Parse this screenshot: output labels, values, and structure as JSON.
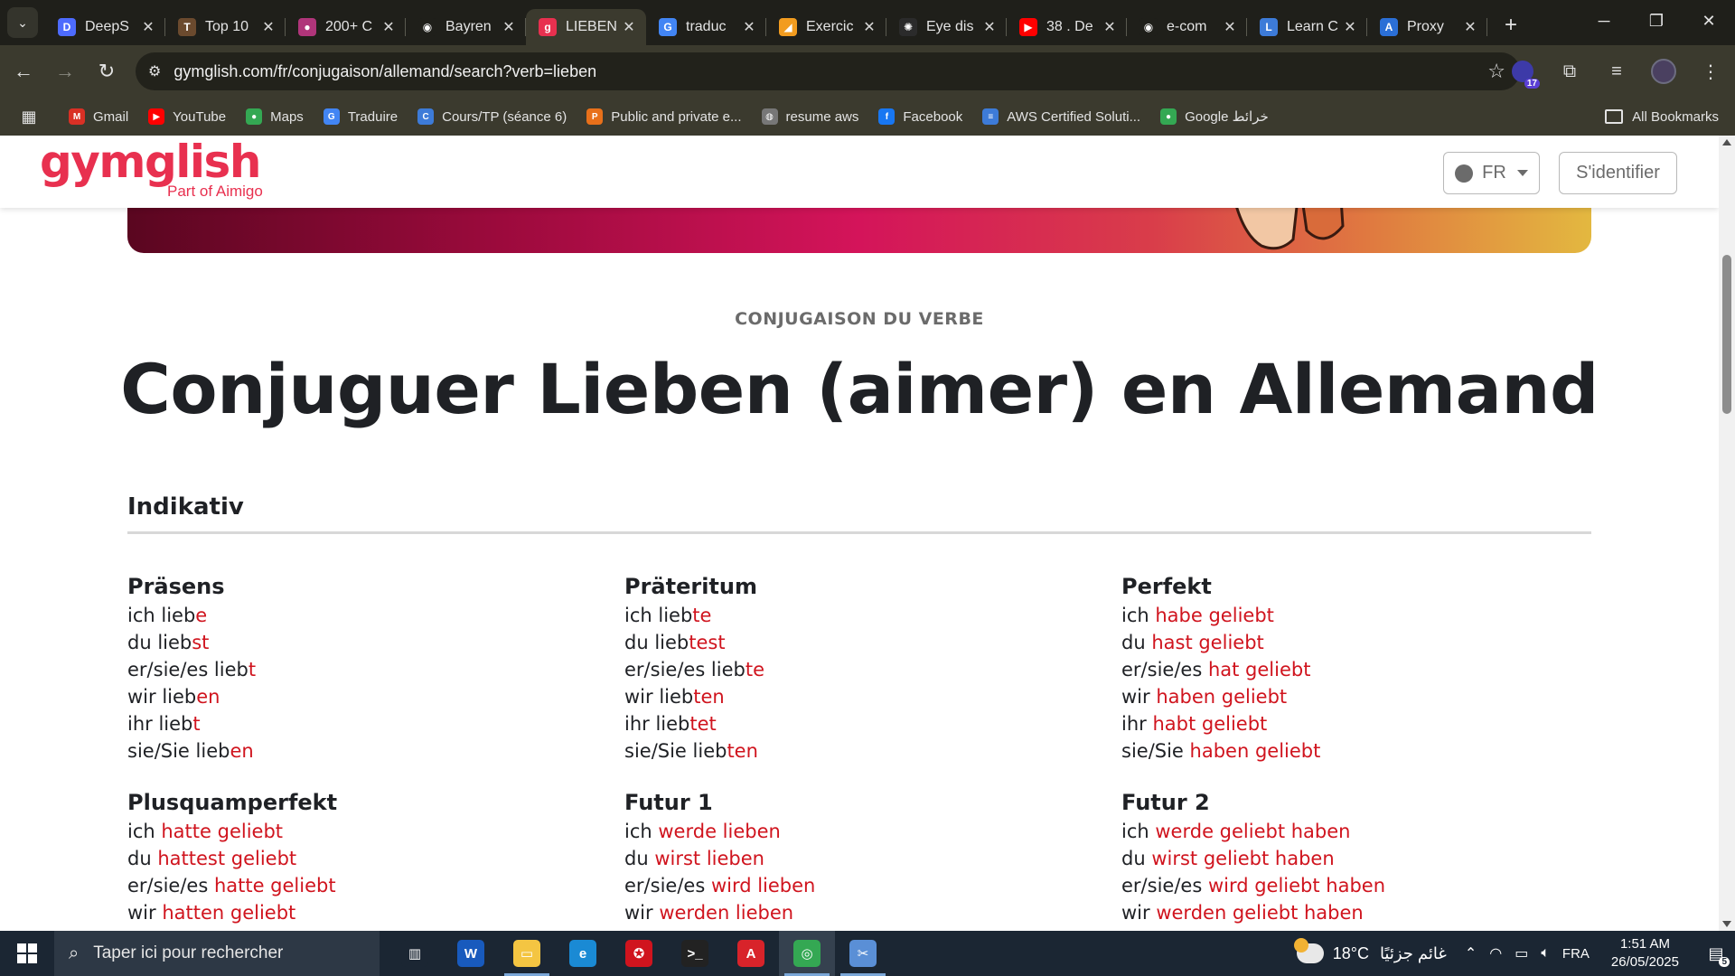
{
  "browser": {
    "tabs": [
      {
        "title": "DeepS",
        "favicon": "deepseek-icon",
        "color": "#4d6bfe",
        "glyph": "D"
      },
      {
        "title": "Top 10",
        "favicon": "page-icon",
        "color": "#6b4a2e",
        "glyph": "T"
      },
      {
        "title": "200+ C",
        "favicon": "colorful-icon",
        "color": "#b0357a",
        "glyph": "●"
      },
      {
        "title": "Bayren",
        "favicon": "github-icon",
        "color": "#1f1f1a",
        "glyph": "◉"
      },
      {
        "title": "LIEBEN",
        "favicon": "gymglish-icon",
        "color": "#e8304f",
        "glyph": "g"
      },
      {
        "title": "traduc",
        "favicon": "google-icon",
        "color": "#4285f4",
        "glyph": "G"
      },
      {
        "title": "Exercic",
        "favicon": "exercise-icon",
        "color": "#f29c1f",
        "glyph": "◢"
      },
      {
        "title": "Eye dis",
        "favicon": "openai-icon",
        "color": "#2b2b2b",
        "glyph": "✺"
      },
      {
        "title": "38 . De",
        "favicon": "youtube-icon",
        "color": "#ff0000",
        "glyph": "▶"
      },
      {
        "title": "e-com",
        "favicon": "github-icon",
        "color": "#1f1f1a",
        "glyph": "◉"
      },
      {
        "title": "Learn C",
        "favicon": "learn-icon",
        "color": "#3d7bd8",
        "glyph": "L"
      },
      {
        "title": "Proxy",
        "favicon": "proxy-icon",
        "color": "#2b6fd6",
        "glyph": "A"
      }
    ],
    "url": "gymglish.com/fr/conjugaison/allemand/search?verb=lieben",
    "extension_badge": "17",
    "bookmarks": [
      {
        "label": "Gmail",
        "icon": "gmail-icon",
        "color": "#d93025",
        "glyph": "M"
      },
      {
        "label": "YouTube",
        "icon": "youtube-icon",
        "color": "#ff0000",
        "glyph": "▶"
      },
      {
        "label": "Maps",
        "icon": "maps-icon",
        "color": "#34a853",
        "glyph": "●"
      },
      {
        "label": "Traduire",
        "icon": "translate-icon",
        "color": "#4285f4",
        "glyph": "G"
      },
      {
        "label": "Cours/TP (séance 6)",
        "icon": "classroom-icon",
        "color": "#3d7bd8",
        "glyph": "C"
      },
      {
        "label": "Public and private e...",
        "icon": "pluralsight-icon",
        "color": "#e8701a",
        "glyph": "P"
      },
      {
        "label": "resume aws",
        "icon": "globe-icon",
        "color": "#777777",
        "glyph": "◍"
      },
      {
        "label": "Facebook",
        "icon": "facebook-icon",
        "color": "#1877f2",
        "glyph": "f"
      },
      {
        "label": "AWS Certified Soluti...",
        "icon": "aws-icon",
        "color": "#3d7bd8",
        "glyph": "≡"
      },
      {
        "label": "Google خرائط",
        "icon": "maps-icon",
        "color": "#34a853",
        "glyph": "●"
      }
    ],
    "all_bookmarks": "All Bookmarks"
  },
  "site": {
    "logo_word": "gymglish",
    "logo_sub": "Part of Aimigo",
    "lang_label": "FR",
    "login_label": "S'identifier"
  },
  "main": {
    "eyebrow": "CONJUGAISON DU VERBE",
    "title": "Conjuguer Lieben (aimer) en Allemand",
    "mood": "Indikativ",
    "tenses": [
      {
        "name": "Präsens",
        "lines": [
          {
            "pre": "ich lieb",
            "end": "e"
          },
          {
            "pre": "du lieb",
            "end": "st"
          },
          {
            "pre": "er/sie/es lieb",
            "end": "t"
          },
          {
            "pre": "wir lieb",
            "end": "en"
          },
          {
            "pre": "ihr lieb",
            "end": "t"
          },
          {
            "pre": "sie/Sie lieb",
            "end": "en"
          }
        ]
      },
      {
        "name": "Präteritum",
        "lines": [
          {
            "pre": "ich lieb",
            "end": "te"
          },
          {
            "pre": "du lieb",
            "end": "test"
          },
          {
            "pre": "er/sie/es lieb",
            "end": "te"
          },
          {
            "pre": "wir lieb",
            "end": "ten"
          },
          {
            "pre": "ihr lieb",
            "end": "tet"
          },
          {
            "pre": "sie/Sie lieb",
            "end": "ten"
          }
        ]
      },
      {
        "name": "Perfekt",
        "lines": [
          {
            "pre": "ich ",
            "end": "habe geliebt"
          },
          {
            "pre": "du ",
            "end": "hast geliebt"
          },
          {
            "pre": "er/sie/es ",
            "end": "hat geliebt"
          },
          {
            "pre": "wir ",
            "end": "haben geliebt"
          },
          {
            "pre": "ihr ",
            "end": "habt geliebt"
          },
          {
            "pre": "sie/Sie ",
            "end": "haben geliebt"
          }
        ]
      },
      {
        "name": "Plusquamperfekt",
        "lines": [
          {
            "pre": "ich ",
            "end": "hatte geliebt"
          },
          {
            "pre": "du ",
            "end": "hattest geliebt"
          },
          {
            "pre": "er/sie/es ",
            "end": "hatte geliebt"
          },
          {
            "pre": "wir ",
            "end": "hatten geliebt"
          }
        ]
      },
      {
        "name": "Futur 1",
        "lines": [
          {
            "pre": "ich ",
            "end": "werde lieben"
          },
          {
            "pre": "du ",
            "end": "wirst lieben"
          },
          {
            "pre": "er/sie/es ",
            "end": "wird lieben"
          },
          {
            "pre": "wir ",
            "end": "werden lieben"
          }
        ]
      },
      {
        "name": "Futur 2",
        "lines": [
          {
            "pre": "ich ",
            "end": "werde geliebt haben"
          },
          {
            "pre": "du ",
            "end": "wirst geliebt haben"
          },
          {
            "pre": "er/sie/es ",
            "end": "wird geliebt haben"
          },
          {
            "pre": "wir ",
            "end": "werden geliebt haben"
          }
        ]
      }
    ]
  },
  "taskbar": {
    "search_placeholder": "Taper ici pour rechercher",
    "apps": [
      {
        "name": "task-view-icon",
        "color": "#1b2633",
        "glyph": "▥",
        "running": false
      },
      {
        "name": "word-icon",
        "color": "#185abd",
        "glyph": "W",
        "running": false
      },
      {
        "name": "file-explorer-icon",
        "color": "#f4c542",
        "glyph": "▭",
        "running": true
      },
      {
        "name": "edge-icon",
        "color": "#1a8ad4",
        "glyph": "e",
        "running": false
      },
      {
        "name": "app-red-icon",
        "color": "#d0141e",
        "glyph": "✪",
        "running": false
      },
      {
        "name": "terminal-icon",
        "color": "#222222",
        "glyph": ">_",
        "running": false
      },
      {
        "name": "acrobat-icon",
        "color": "#d8232a",
        "glyph": "A",
        "running": false
      },
      {
        "name": "chrome-icon",
        "color": "#34a853",
        "glyph": "◎",
        "running": true,
        "active": true
      },
      {
        "name": "snipping-icon",
        "color": "#5a8fd6",
        "glyph": "✂",
        "running": true
      }
    ],
    "weather_temp": "18°C",
    "weather_text": "غائم جزئيًا",
    "weather_badge": "1",
    "language": "FRA",
    "time": "1:51 AM",
    "date": "26/05/2025",
    "notifications": "5"
  }
}
